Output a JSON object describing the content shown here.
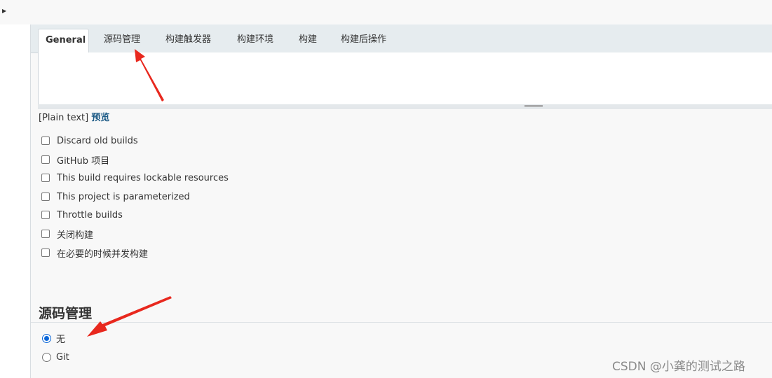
{
  "tabs": [
    {
      "label": "General",
      "active": true
    },
    {
      "label": "源码管理",
      "active": false
    },
    {
      "label": "构建触发器",
      "active": false
    },
    {
      "label": "构建环境",
      "active": false
    },
    {
      "label": "构建",
      "active": false
    },
    {
      "label": "构建后操作",
      "active": false
    }
  ],
  "description": {
    "format_label": "[Plain text]",
    "preview_label": "预览"
  },
  "options": [
    {
      "label": "Discard old builds",
      "checked": false
    },
    {
      "label": "GitHub 项目",
      "checked": false
    },
    {
      "label": "This build requires lockable resources",
      "checked": false
    },
    {
      "label": "This project is parameterized",
      "checked": false
    },
    {
      "label": "Throttle builds",
      "checked": false
    },
    {
      "label": "关闭构建",
      "checked": false
    },
    {
      "label": "在必要的时候并发构建",
      "checked": false
    }
  ],
  "scm": {
    "title": "源码管理",
    "choices": [
      {
        "label": "无",
        "selected": true
      },
      {
        "label": "Git",
        "selected": false
      }
    ]
  },
  "watermark": "CSDN @小龚的测试之路",
  "colors": {
    "annotation_arrow": "#e8281e",
    "accent": "#0a66d8",
    "link": "#1f5c87"
  }
}
